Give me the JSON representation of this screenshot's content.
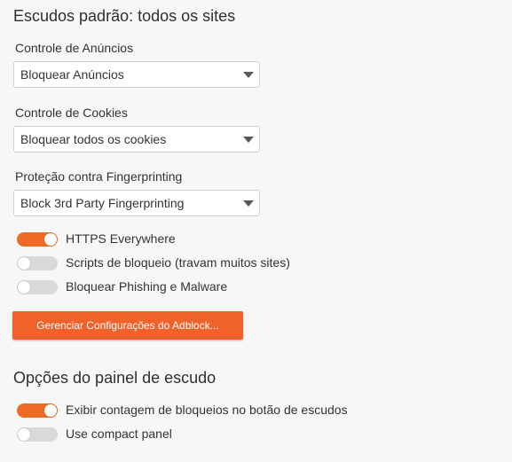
{
  "shields": {
    "title": "Escudos padrão: todos os sites",
    "ads": {
      "label": "Controle de Anúncios",
      "selected": "Bloquear Anúncios"
    },
    "cookies": {
      "label": "Controle de Cookies",
      "selected": "Bloquear todos os cookies"
    },
    "fingerprinting": {
      "label": "Proteção contra Fingerprinting",
      "selected": "Block 3rd Party Fingerprinting"
    },
    "toggles": [
      {
        "label": "HTTPS Everywhere",
        "on": true
      },
      {
        "label": "Scripts de bloqueio (travam muitos sites)",
        "on": false
      },
      {
        "label": "Bloquear Phishing e Malware",
        "on": false
      }
    ],
    "adblock_button": "Gerenciar Configurações do Adblock..."
  },
  "panel": {
    "title": "Opções do painel de escudo",
    "toggles": [
      {
        "label": "Exibir contagem de bloqueios no botão de escudos",
        "on": true
      },
      {
        "label": "Use compact panel",
        "on": false
      }
    ]
  },
  "colors": {
    "accent": "#ef6a24",
    "toggle_off": "#d9d9d9",
    "background": "#f7f7f7"
  }
}
